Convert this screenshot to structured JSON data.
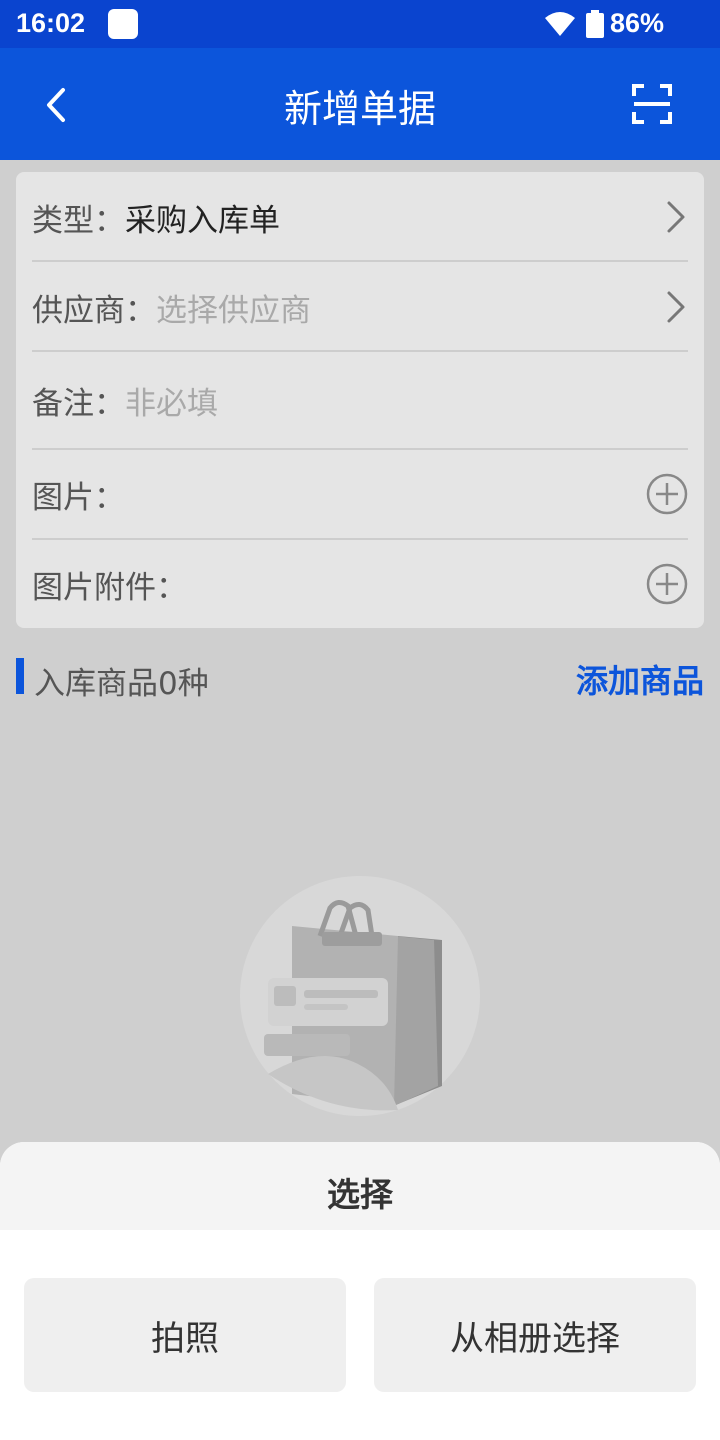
{
  "status_bar": {
    "time": "16:02",
    "battery": "86%"
  },
  "app_bar": {
    "title": "新增单据",
    "back_icon": "back-icon",
    "scan_icon": "scan-icon"
  },
  "form": {
    "type": {
      "label": "类型：",
      "value": "采购入库单"
    },
    "supplier": {
      "label": "供应商：",
      "placeholder": "选择供应商"
    },
    "remark": {
      "label": "备注：",
      "placeholder": "非必填"
    },
    "images": {
      "label": "图片："
    },
    "attachments": {
      "label": "图片附件："
    }
  },
  "goods_section": {
    "title": "入库商品0种",
    "add_label": "添加商品"
  },
  "sheet": {
    "title": "选择",
    "camera_label": "拍照",
    "album_label": "从相册选择"
  },
  "colors": {
    "primary": "#0c55db",
    "status_bar": "#0a44cf",
    "card": "#e5e5e5",
    "overlay": "#cfcfcf"
  }
}
